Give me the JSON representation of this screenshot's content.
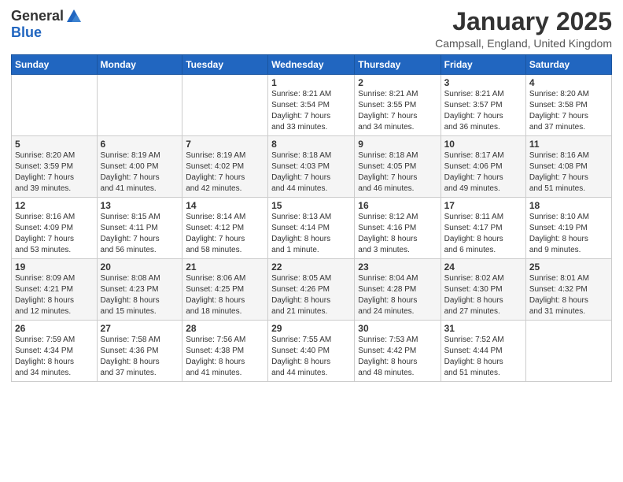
{
  "logo": {
    "general": "General",
    "blue": "Blue"
  },
  "header": {
    "month": "January 2025",
    "location": "Campsall, England, United Kingdom"
  },
  "weekdays": [
    "Sunday",
    "Monday",
    "Tuesday",
    "Wednesday",
    "Thursday",
    "Friday",
    "Saturday"
  ],
  "weeks": [
    [
      {
        "day": "",
        "info": ""
      },
      {
        "day": "",
        "info": ""
      },
      {
        "day": "",
        "info": ""
      },
      {
        "day": "1",
        "info": "Sunrise: 8:21 AM\nSunset: 3:54 PM\nDaylight: 7 hours\nand 33 minutes."
      },
      {
        "day": "2",
        "info": "Sunrise: 8:21 AM\nSunset: 3:55 PM\nDaylight: 7 hours\nand 34 minutes."
      },
      {
        "day": "3",
        "info": "Sunrise: 8:21 AM\nSunset: 3:57 PM\nDaylight: 7 hours\nand 36 minutes."
      },
      {
        "day": "4",
        "info": "Sunrise: 8:20 AM\nSunset: 3:58 PM\nDaylight: 7 hours\nand 37 minutes."
      }
    ],
    [
      {
        "day": "5",
        "info": "Sunrise: 8:20 AM\nSunset: 3:59 PM\nDaylight: 7 hours\nand 39 minutes."
      },
      {
        "day": "6",
        "info": "Sunrise: 8:19 AM\nSunset: 4:00 PM\nDaylight: 7 hours\nand 41 minutes."
      },
      {
        "day": "7",
        "info": "Sunrise: 8:19 AM\nSunset: 4:02 PM\nDaylight: 7 hours\nand 42 minutes."
      },
      {
        "day": "8",
        "info": "Sunrise: 8:18 AM\nSunset: 4:03 PM\nDaylight: 7 hours\nand 44 minutes."
      },
      {
        "day": "9",
        "info": "Sunrise: 8:18 AM\nSunset: 4:05 PM\nDaylight: 7 hours\nand 46 minutes."
      },
      {
        "day": "10",
        "info": "Sunrise: 8:17 AM\nSunset: 4:06 PM\nDaylight: 7 hours\nand 49 minutes."
      },
      {
        "day": "11",
        "info": "Sunrise: 8:16 AM\nSunset: 4:08 PM\nDaylight: 7 hours\nand 51 minutes."
      }
    ],
    [
      {
        "day": "12",
        "info": "Sunrise: 8:16 AM\nSunset: 4:09 PM\nDaylight: 7 hours\nand 53 minutes."
      },
      {
        "day": "13",
        "info": "Sunrise: 8:15 AM\nSunset: 4:11 PM\nDaylight: 7 hours\nand 56 minutes."
      },
      {
        "day": "14",
        "info": "Sunrise: 8:14 AM\nSunset: 4:12 PM\nDaylight: 7 hours\nand 58 minutes."
      },
      {
        "day": "15",
        "info": "Sunrise: 8:13 AM\nSunset: 4:14 PM\nDaylight: 8 hours\nand 1 minute."
      },
      {
        "day": "16",
        "info": "Sunrise: 8:12 AM\nSunset: 4:16 PM\nDaylight: 8 hours\nand 3 minutes."
      },
      {
        "day": "17",
        "info": "Sunrise: 8:11 AM\nSunset: 4:17 PM\nDaylight: 8 hours\nand 6 minutes."
      },
      {
        "day": "18",
        "info": "Sunrise: 8:10 AM\nSunset: 4:19 PM\nDaylight: 8 hours\nand 9 minutes."
      }
    ],
    [
      {
        "day": "19",
        "info": "Sunrise: 8:09 AM\nSunset: 4:21 PM\nDaylight: 8 hours\nand 12 minutes."
      },
      {
        "day": "20",
        "info": "Sunrise: 8:08 AM\nSunset: 4:23 PM\nDaylight: 8 hours\nand 15 minutes."
      },
      {
        "day": "21",
        "info": "Sunrise: 8:06 AM\nSunset: 4:25 PM\nDaylight: 8 hours\nand 18 minutes."
      },
      {
        "day": "22",
        "info": "Sunrise: 8:05 AM\nSunset: 4:26 PM\nDaylight: 8 hours\nand 21 minutes."
      },
      {
        "day": "23",
        "info": "Sunrise: 8:04 AM\nSunset: 4:28 PM\nDaylight: 8 hours\nand 24 minutes."
      },
      {
        "day": "24",
        "info": "Sunrise: 8:02 AM\nSunset: 4:30 PM\nDaylight: 8 hours\nand 27 minutes."
      },
      {
        "day": "25",
        "info": "Sunrise: 8:01 AM\nSunset: 4:32 PM\nDaylight: 8 hours\nand 31 minutes."
      }
    ],
    [
      {
        "day": "26",
        "info": "Sunrise: 7:59 AM\nSunset: 4:34 PM\nDaylight: 8 hours\nand 34 minutes."
      },
      {
        "day": "27",
        "info": "Sunrise: 7:58 AM\nSunset: 4:36 PM\nDaylight: 8 hours\nand 37 minutes."
      },
      {
        "day": "28",
        "info": "Sunrise: 7:56 AM\nSunset: 4:38 PM\nDaylight: 8 hours\nand 41 minutes."
      },
      {
        "day": "29",
        "info": "Sunrise: 7:55 AM\nSunset: 4:40 PM\nDaylight: 8 hours\nand 44 minutes."
      },
      {
        "day": "30",
        "info": "Sunrise: 7:53 AM\nSunset: 4:42 PM\nDaylight: 8 hours\nand 48 minutes."
      },
      {
        "day": "31",
        "info": "Sunrise: 7:52 AM\nSunset: 4:44 PM\nDaylight: 8 hours\nand 51 minutes."
      },
      {
        "day": "",
        "info": ""
      }
    ]
  ]
}
